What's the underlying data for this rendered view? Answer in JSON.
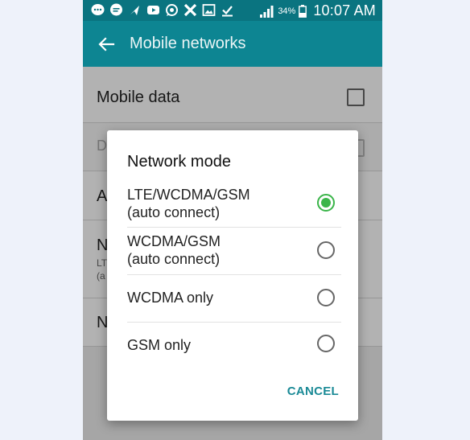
{
  "status_bar": {
    "icons": [
      "messenger-icon",
      "chat-icon",
      "navigation-icon",
      "youtube-icon",
      "whatsapp-icon",
      "x-icon",
      "gallery-icon",
      "download-icon"
    ],
    "battery_percent": "34%",
    "time": "10:07 AM"
  },
  "action_bar": {
    "title": "Mobile networks"
  },
  "settings_list": {
    "mobile_data_label": "Mobile data",
    "row2_letter": "D",
    "row3_letter": "A",
    "row4_letter": "N",
    "row4_sub1": "LT",
    "row4_sub2": "(a",
    "row5_letter": "N"
  },
  "dialog": {
    "title": "Network mode",
    "options": [
      {
        "line1": "LTE/WCDMA/GSM",
        "line2": "(auto connect)",
        "selected": true
      },
      {
        "line1": "WCDMA/GSM",
        "line2": "(auto connect)",
        "selected": false
      },
      {
        "line1": "WCDMA only",
        "line2": "",
        "selected": false
      },
      {
        "line1": "GSM only",
        "line2": "",
        "selected": false
      }
    ],
    "cancel_label": "CANCEL"
  },
  "colors": {
    "status_bar": "#0a7480",
    "action_bar": "#0d8592",
    "radio_selected": "#3bb54a",
    "accent_text": "#1a8a96"
  }
}
